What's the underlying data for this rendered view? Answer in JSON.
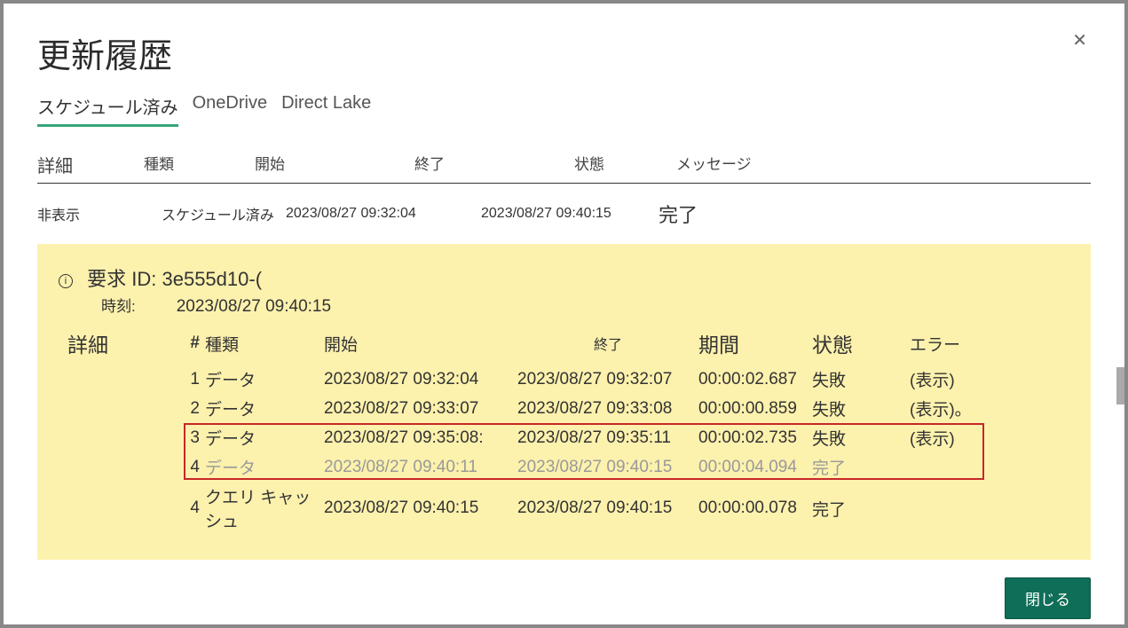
{
  "dialog": {
    "title": "更新履歴",
    "close_label": "閉じる"
  },
  "tabs": {
    "scheduled": "スケジュール済み",
    "onedrive": "OneDrive",
    "directlake": "Direct Lake"
  },
  "headers": {
    "detail": "詳細",
    "kind": "種類",
    "start": "開始",
    "end": "終了",
    "status": "状態",
    "message": "メッセージ"
  },
  "main_row": {
    "detail": "非表示",
    "kind": "スケジュール済み",
    "start": "2023/08/27 09:32:04",
    "end": "2023/08/27 09:40:15",
    "status": "完了"
  },
  "detail": {
    "request_label": "要求 ID:",
    "request_id": "3e555d10-(",
    "time_label": "時刻:",
    "time_value": "2023/08/27 09:40:15",
    "section_label": "詳細",
    "headers": {
      "num": "#",
      "kind": "種類",
      "start": "開始",
      "end": "終了",
      "duration": "期間",
      "status": "状態",
      "error": "エラー"
    },
    "rows": [
      {
        "num": "1",
        "kind": "データ",
        "start": "2023/08/27 09:32:04",
        "end": "2023/08/27 09:32:07",
        "duration": "00:00:02.687",
        "status": "失敗",
        "error": "(表示)"
      },
      {
        "num": "2",
        "kind": "データ",
        "start": "2023/08/27 09:33:07",
        "end": "2023/08/27 09:33:08",
        "duration": "00:00:00.859",
        "status": "失敗",
        "error": "(表示)。"
      },
      {
        "num": "3",
        "kind": "データ",
        "start": "2023/08/27 09:35:08:",
        "end": "2023/08/27 09:35:11",
        "duration": "00:00:02.735",
        "status": "失敗",
        "error": "(表示)"
      },
      {
        "num": "4",
        "kind": "データ",
        "start": "2023/08/27 09:40:11",
        "end": "2023/08/27 09:40:15",
        "duration": "00:00:04.094",
        "status": "完了",
        "error": ""
      },
      {
        "num": "4",
        "kind": "クエリ キャッシュ",
        "start": "2023/08/27 09:40:15",
        "end": "2023/08/27 09:40:15",
        "duration": "00:00:00.078",
        "status": "完了",
        "error": ""
      }
    ]
  }
}
